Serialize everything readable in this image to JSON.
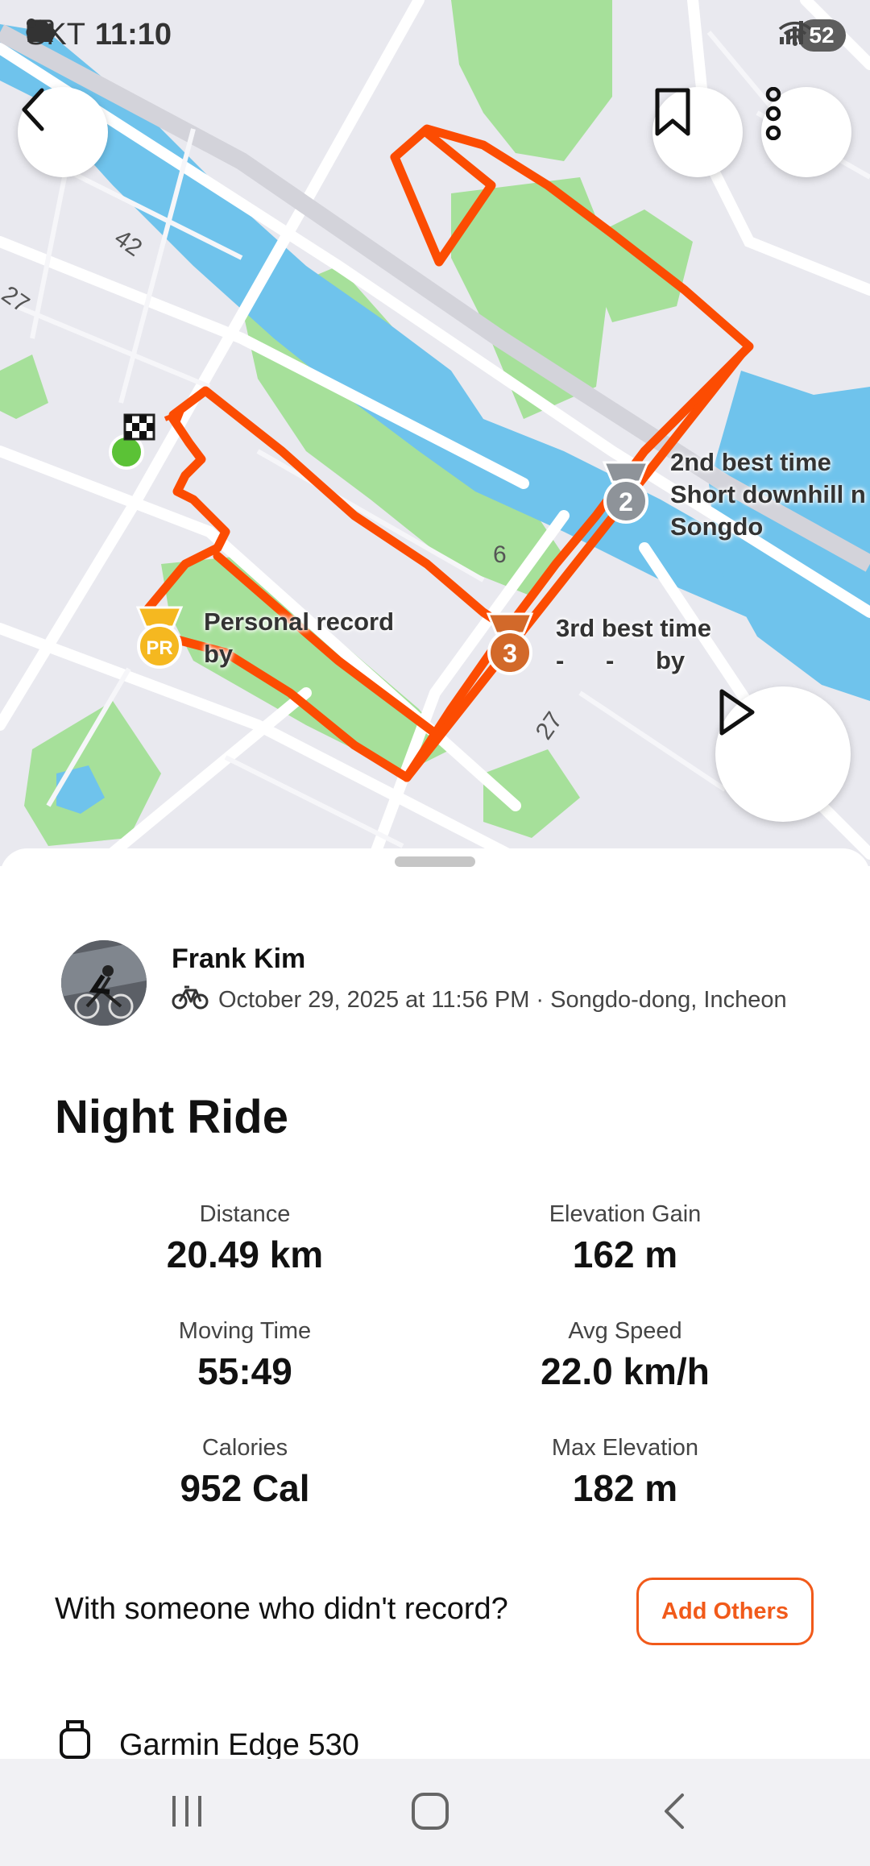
{
  "status_bar": {
    "carrier": "SKT",
    "time": "11:10",
    "battery": "52"
  },
  "map": {
    "road_labels": [
      "42",
      "27",
      "6",
      "27"
    ],
    "labels": {
      "second_best": "2nd best time\nShort downhill n\nSongdo",
      "personal_record": "Personal record\nby",
      "third_best": "3rd best time\n-      -      by"
    },
    "medals": {
      "second": "2",
      "pr": "PR",
      "third": "3"
    },
    "colors": {
      "route": "#fc4c02",
      "park": "#a6e09a",
      "water": "#6fc3ec"
    }
  },
  "activity": {
    "athlete": "Frank Kim",
    "meta": "October 29, 2025 at 11:56 PM · Songdo-dong, Incheon",
    "title": "Night Ride",
    "stats": [
      {
        "label": "Distance",
        "value": "20.49 km"
      },
      {
        "label": "Elevation Gain",
        "value": "162 m"
      },
      {
        "label": "Moving Time",
        "value": "55:49"
      },
      {
        "label": "Avg Speed",
        "value": "22.0 km/h"
      },
      {
        "label": "Calories",
        "value": "952 Cal"
      },
      {
        "label": "Max Elevation",
        "value": "182 m"
      }
    ],
    "with_prompt": "With someone who didn't record?",
    "add_others": "Add Others",
    "device": "Garmin Edge 530"
  },
  "icons": {
    "back": "back-arrow-icon",
    "bookmark": "bookmark-icon",
    "more": "more-vertical-icon",
    "play": "play-icon",
    "bike": "bike-icon",
    "device": "watch-icon"
  }
}
